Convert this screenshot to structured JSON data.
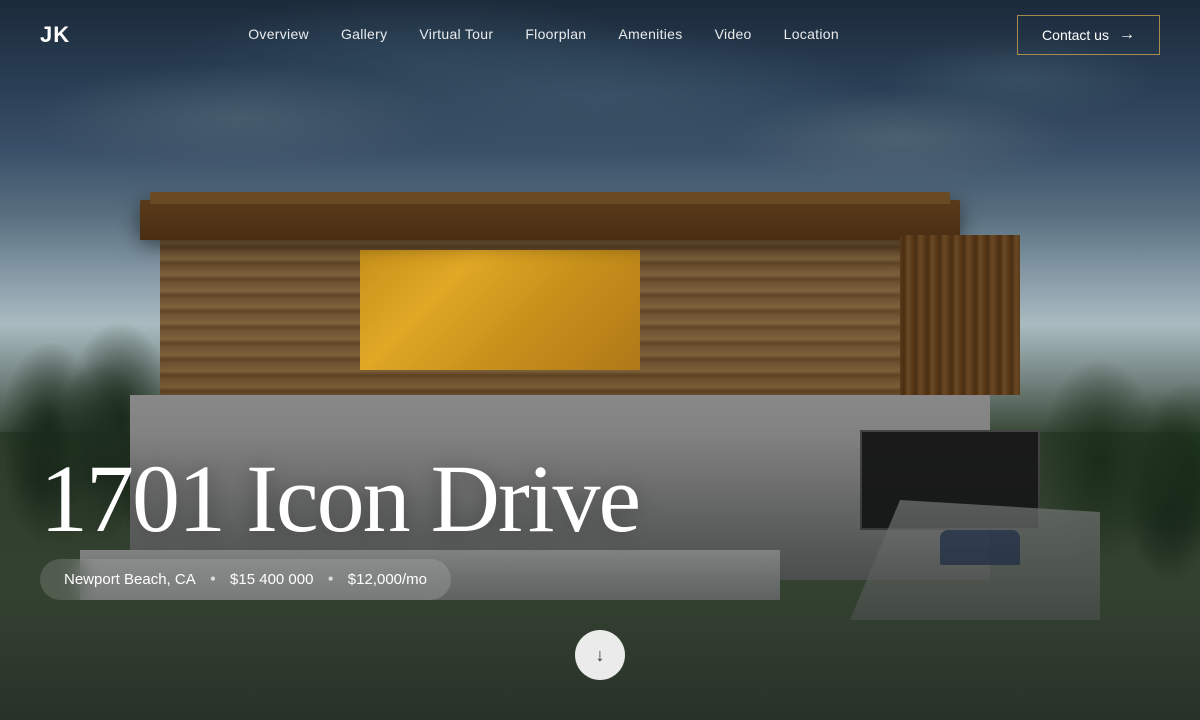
{
  "logo": "JK",
  "nav": {
    "links": [
      {
        "label": "Overview",
        "id": "overview"
      },
      {
        "label": "Gallery",
        "id": "gallery"
      },
      {
        "label": "Virtual Tour",
        "id": "virtual-tour"
      },
      {
        "label": "Floorplan",
        "id": "floorplan"
      },
      {
        "label": "Amenities",
        "id": "amenities"
      },
      {
        "label": "Video",
        "id": "video"
      },
      {
        "label": "Location",
        "id": "location"
      }
    ],
    "contact_label": "Contact us",
    "contact_arrow": "→"
  },
  "hero": {
    "title": "1701 Icon Drive",
    "location": "Newport Beach, CA",
    "price": "$15 400 000",
    "rent": "$12,000/mo",
    "dot": "•"
  },
  "scroll": {
    "arrow": "↓"
  }
}
